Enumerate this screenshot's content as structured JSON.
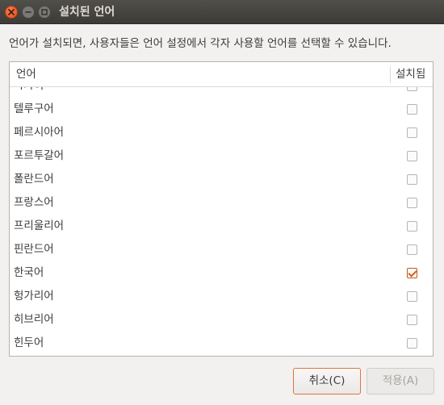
{
  "window": {
    "title": "설치된 언어"
  },
  "description": "언어가 설치되면, 사용자들은 언어 설정에서 각자 사용할 언어를 선택할 수 있습니다.",
  "table": {
    "columns": [
      "언어",
      "설치됨"
    ],
    "rows": [
      {
        "label": "타가이",
        "installed": false
      },
      {
        "label": "텔루구어",
        "installed": false
      },
      {
        "label": "페르시아어",
        "installed": false
      },
      {
        "label": "포르투갈어",
        "installed": false
      },
      {
        "label": "폴란드어",
        "installed": false
      },
      {
        "label": "프랑스어",
        "installed": false
      },
      {
        "label": "프리울리어",
        "installed": false
      },
      {
        "label": "핀란드어",
        "installed": false
      },
      {
        "label": "한국어",
        "installed": true
      },
      {
        "label": "헝가리어",
        "installed": false
      },
      {
        "label": "히브리어",
        "installed": false
      },
      {
        "label": "힌두어",
        "installed": false
      }
    ]
  },
  "buttons": {
    "cancel": "취소(C)",
    "apply": "적용(A)"
  },
  "colors": {
    "accent": "#e0733c",
    "titlebar": "#3c3b37",
    "close": "#e4511c"
  }
}
